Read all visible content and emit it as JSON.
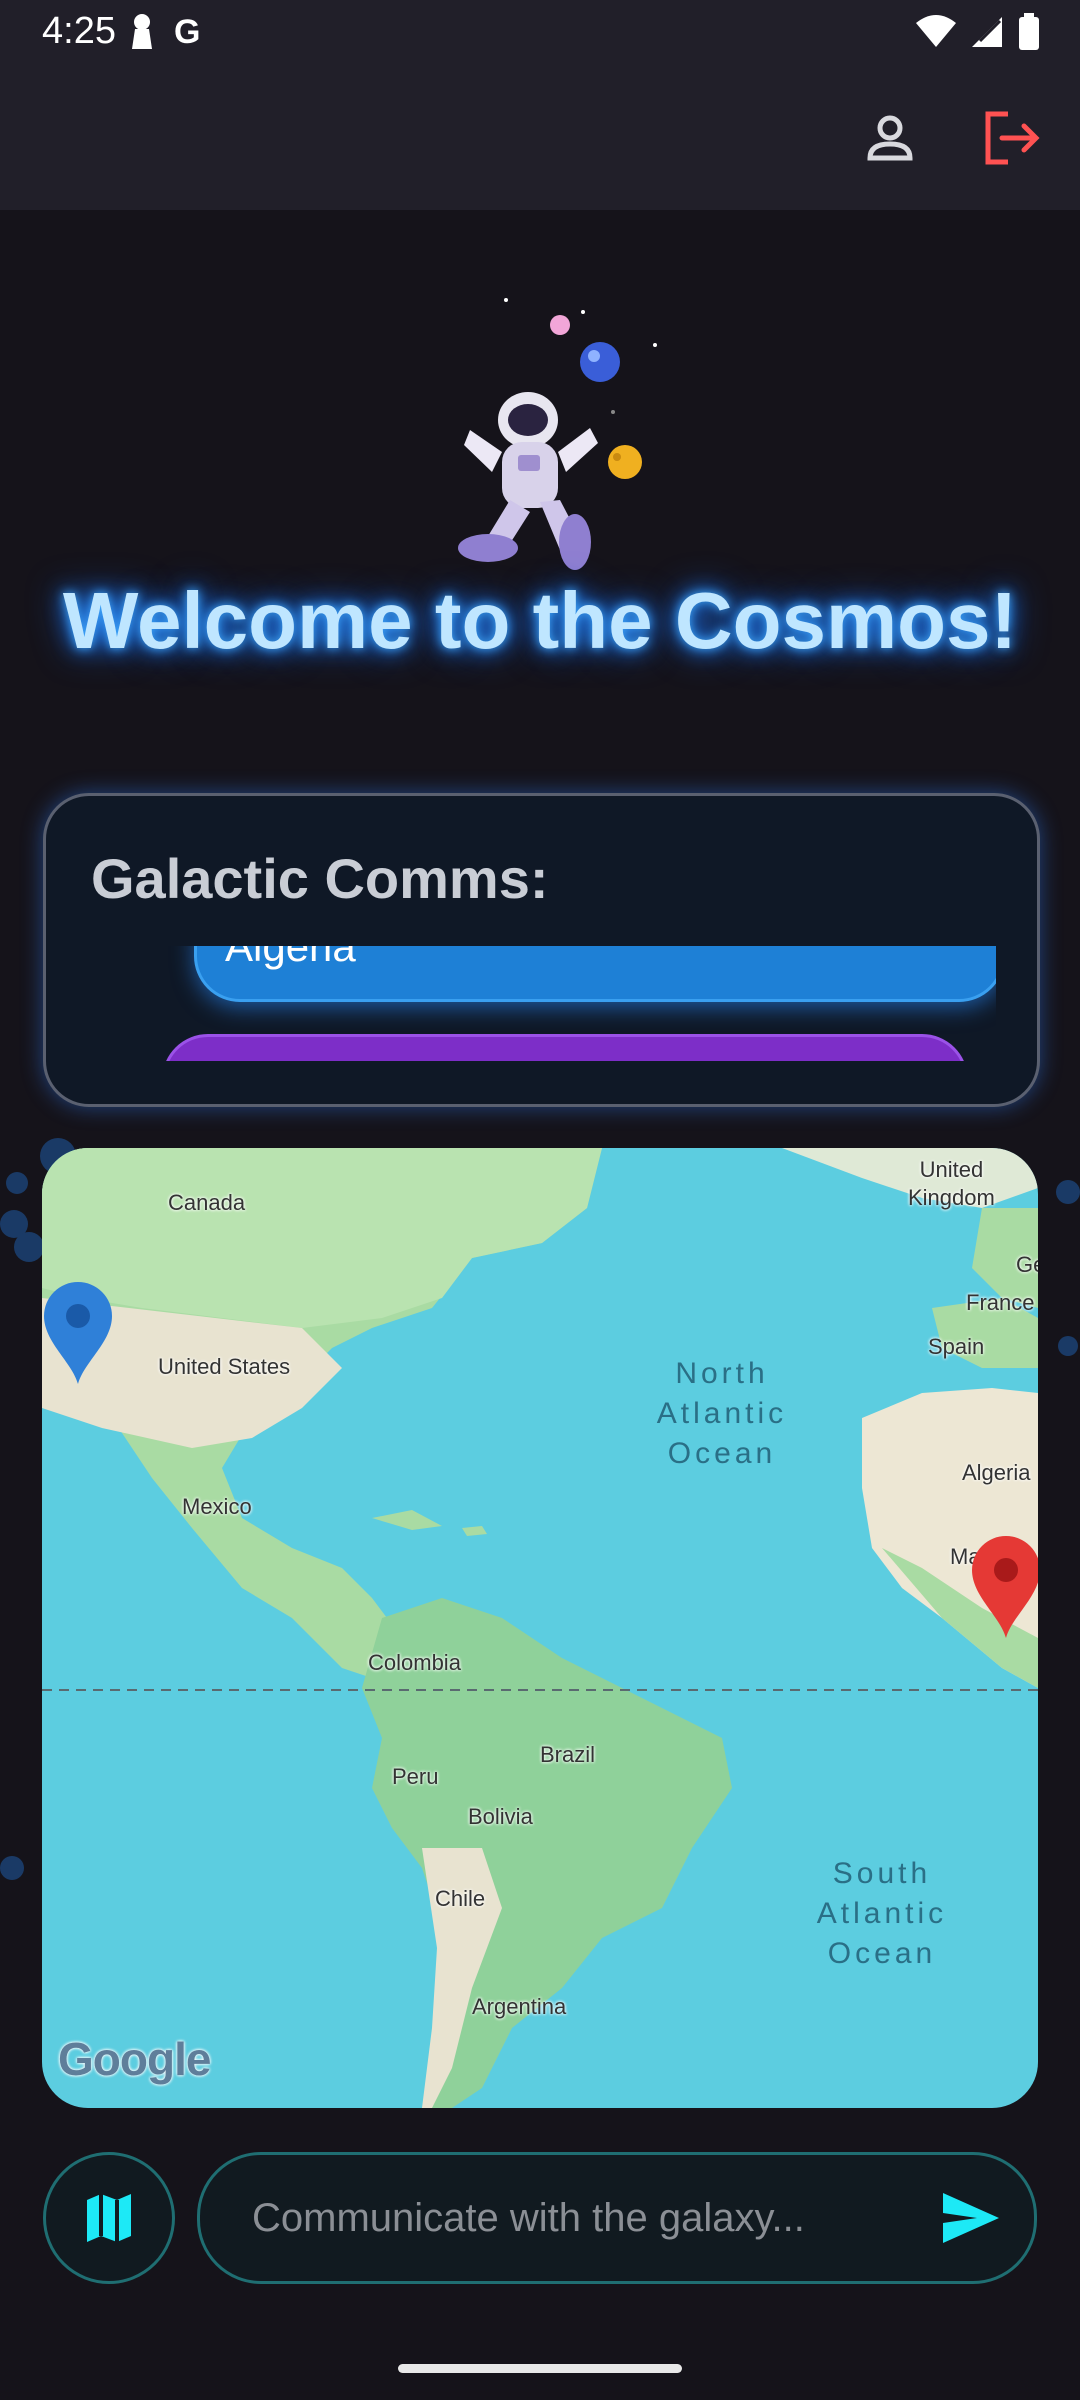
{
  "status_bar": {
    "time": "4:25",
    "g_label": "G"
  },
  "app_bar": {
    "profile_icon": "person-outline-icon",
    "logout_icon": "logout-icon",
    "logout_color": "#ff5252"
  },
  "hero": {
    "welcome": "Welcome to the Cosmos!"
  },
  "comms": {
    "title": "Galactic Comms:",
    "messages": [
      {
        "text": "Algeria",
        "color": "#1e80d6"
      },
      {
        "text": "",
        "color": "#7d2ec8"
      }
    ]
  },
  "map": {
    "labels": {
      "canada": "Canada",
      "united_states": "United States",
      "mexico": "Mexico",
      "colombia": "Colombia",
      "peru": "Peru",
      "brazil": "Brazil",
      "bolivia": "Bolivia",
      "chile": "Chile",
      "argentina": "Argentina",
      "united_kingdom": "United\nKingdom",
      "ge": "Ge",
      "france": "France",
      "spain": "Spain",
      "algeria": "Algeria",
      "ma": "Ma",
      "north_atlantic": "North\nAtlantic\nOcean",
      "south_atlantic": "South\nAtlantic\nOcean"
    },
    "google_logo": "Google",
    "pins": {
      "blue_color": "#2f80d8",
      "red_color": "#e53935"
    }
  },
  "composer": {
    "placeholder": "Communicate with the galaxy...",
    "value": "",
    "accent": "#1de9f6"
  }
}
